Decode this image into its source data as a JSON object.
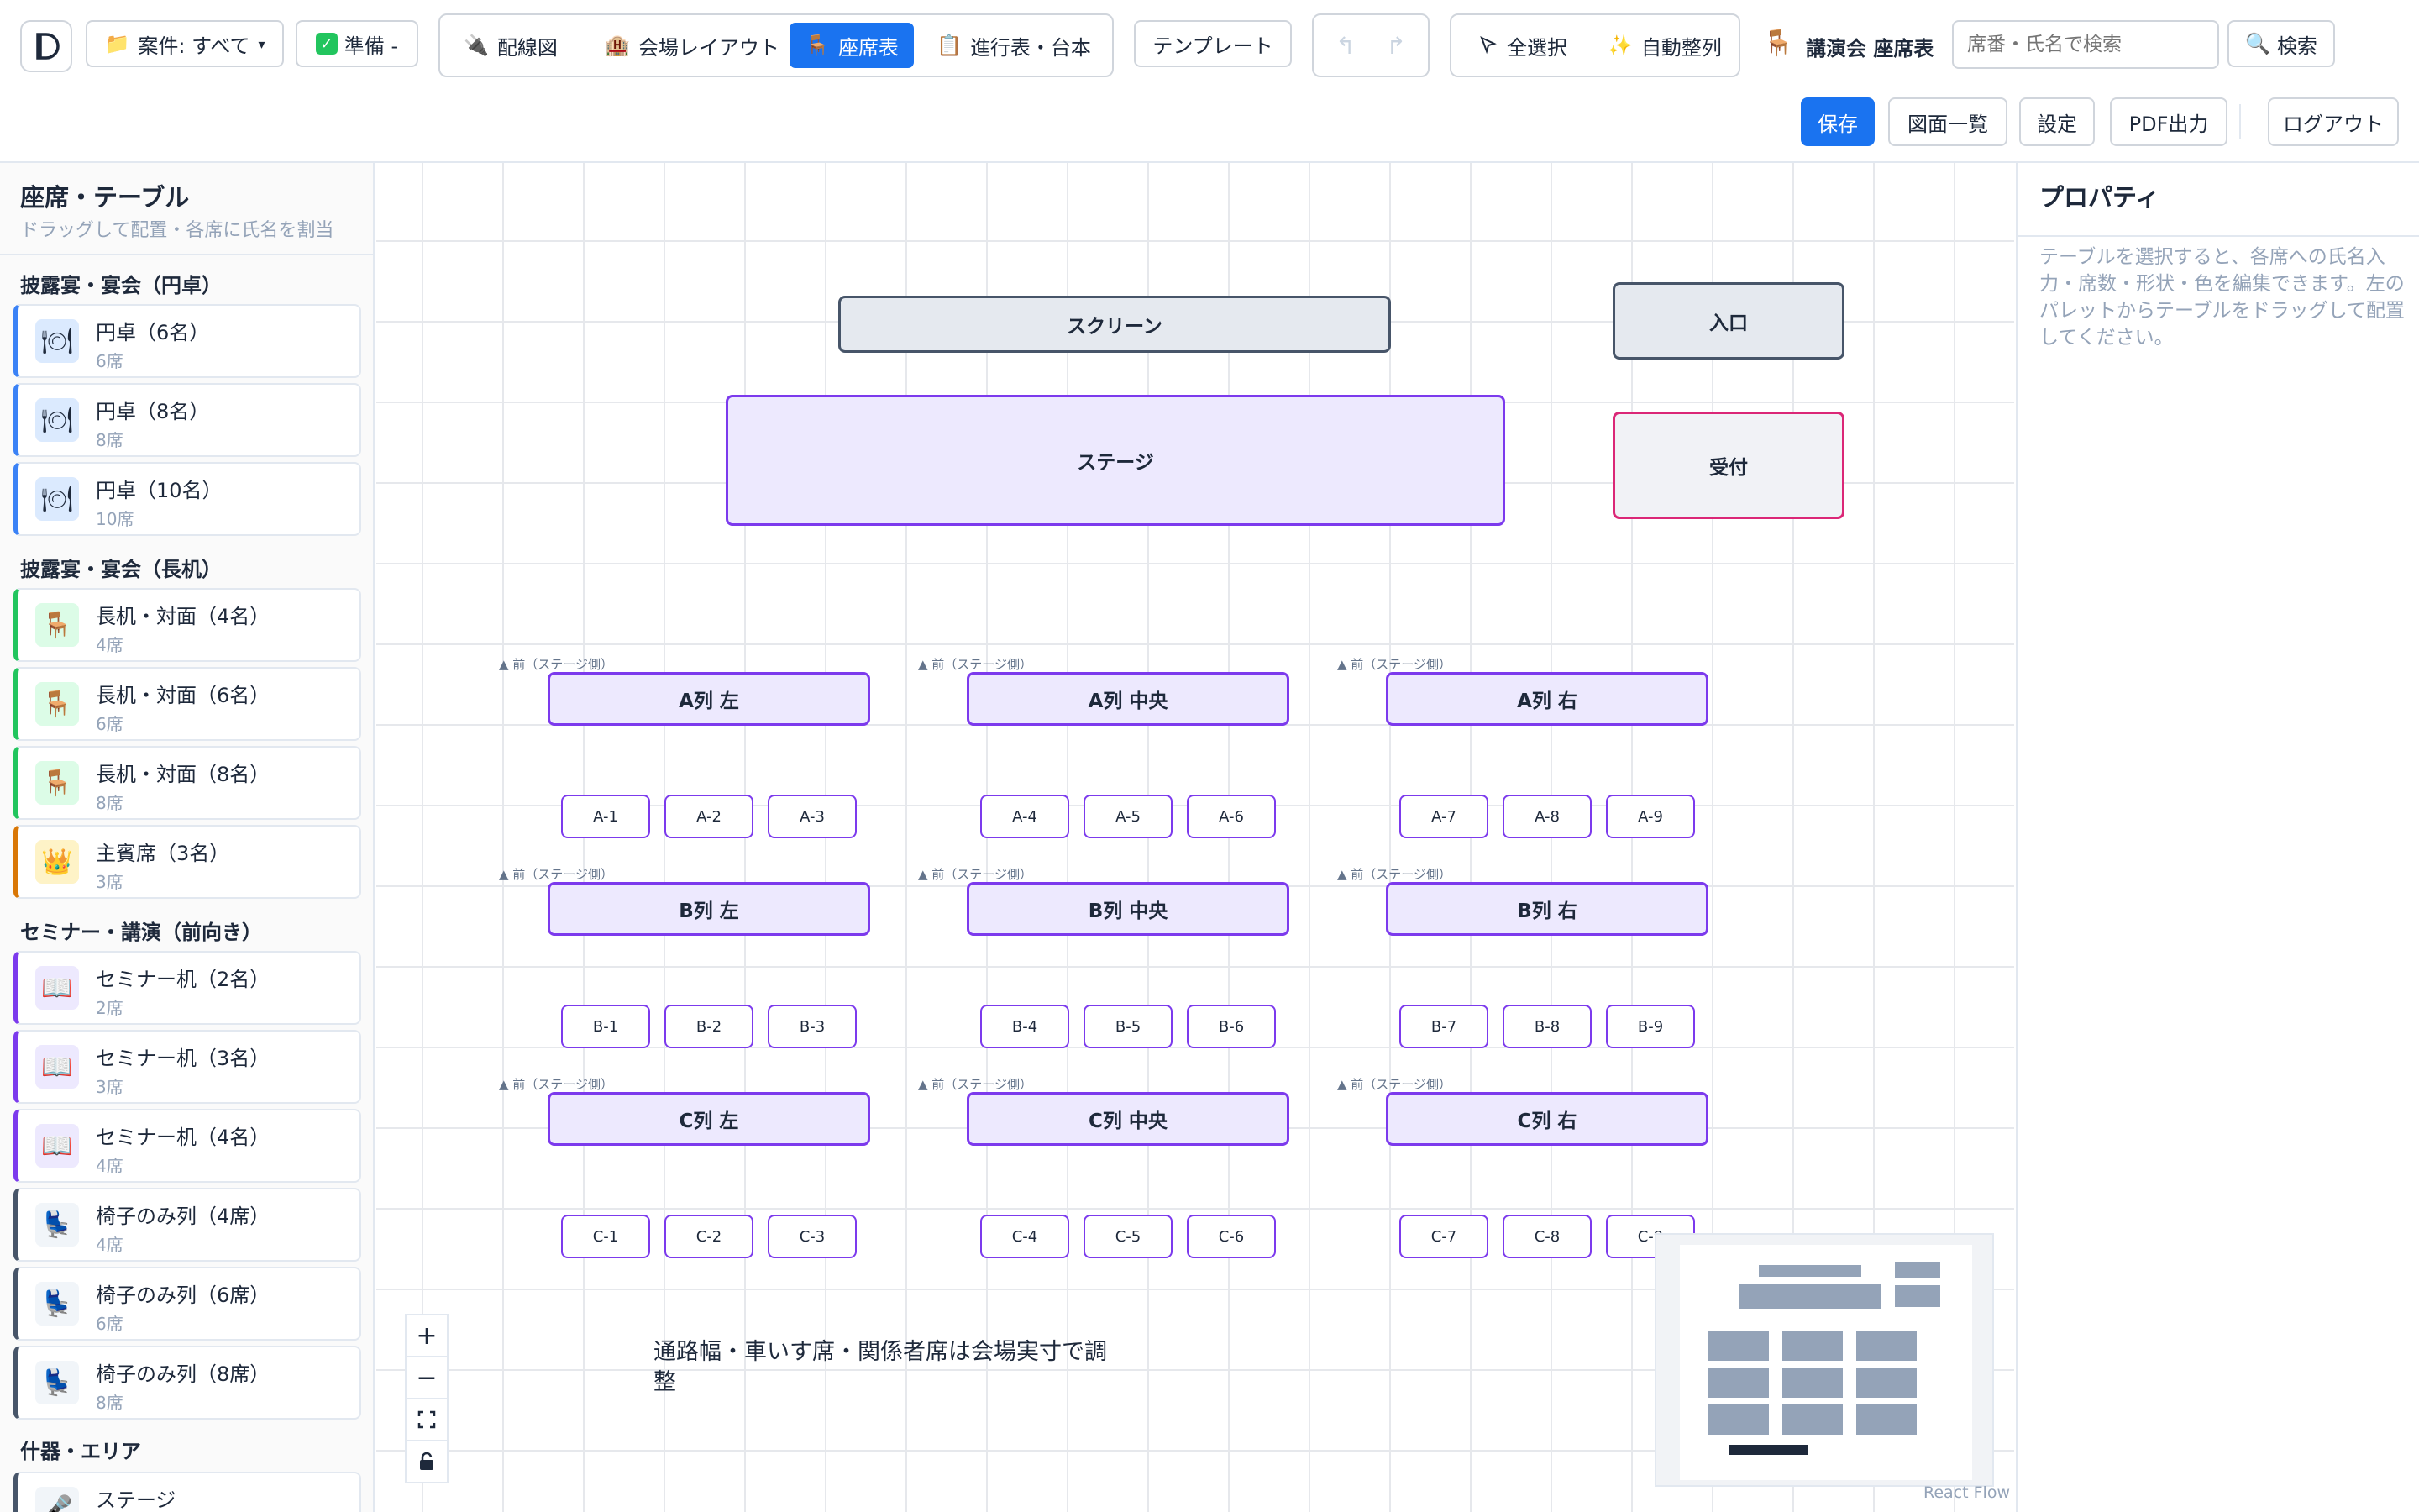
{
  "toolbar": {
    "project_filter": "案件: すべて",
    "status_filter": "準備 -",
    "tabs": [
      {
        "label": "配線図",
        "icon": "plug-icon"
      },
      {
        "label": "会場レイアウト",
        "icon": "building-icon"
      },
      {
        "label": "座席表",
        "icon": "chair-icon",
        "active": true
      },
      {
        "label": "進行表・台本",
        "icon": "clipboard-icon"
      }
    ],
    "template": "テンプレート",
    "select_all": "全選択",
    "auto_align": "自動整列",
    "doc_title": "講演会 座席表",
    "search_placeholder": "席番・氏名で検索",
    "search": "検索",
    "save": "保存",
    "drawings": "図面一覧",
    "settings": "設定",
    "pdf": "PDF出力",
    "logout": "ログアウト"
  },
  "sidebar": {
    "title": "座席・テーブル",
    "subtitle": "ドラッグして配置・各席に氏名を割当",
    "sections": [
      {
        "title": "披露宴・宴会（円卓）",
        "items": [
          {
            "label": "円卓（6名）",
            "sub": "6席",
            "icon": "plate-icon"
          },
          {
            "label": "円卓（8名）",
            "sub": "8席",
            "icon": "plate-icon"
          },
          {
            "label": "円卓（10名）",
            "sub": "10席",
            "icon": "plate-icon"
          }
        ]
      },
      {
        "title": "披露宴・宴会（長机）",
        "items": [
          {
            "label": "長机・対面（4名）",
            "sub": "4席",
            "icon": "chair-icon"
          },
          {
            "label": "長机・対面（6名）",
            "sub": "6席",
            "icon": "chair-icon"
          },
          {
            "label": "長机・対面（8名）",
            "sub": "8席",
            "icon": "chair-icon"
          },
          {
            "label": "主賓席（3名）",
            "sub": "3席",
            "icon": "crown-icon"
          }
        ]
      },
      {
        "title": "セミナー・講演（前向き）",
        "items": [
          {
            "label": "セミナー机（2名）",
            "sub": "2席",
            "icon": "book-icon"
          },
          {
            "label": "セミナー机（3名）",
            "sub": "3席",
            "icon": "book-icon"
          },
          {
            "label": "セミナー机（4名）",
            "sub": "4席",
            "icon": "book-icon"
          },
          {
            "label": "椅子のみ列（4席）",
            "sub": "4席",
            "icon": "seat-icon"
          },
          {
            "label": "椅子のみ列（6席）",
            "sub": "6席",
            "icon": "seat-icon"
          },
          {
            "label": "椅子のみ列（8席）",
            "sub": "8席",
            "icon": "seat-icon"
          }
        ]
      },
      {
        "title": "什器・エリア",
        "items": [
          {
            "label": "ステージ",
            "sub": "",
            "icon": "mic-icon"
          }
        ]
      }
    ]
  },
  "canvas": {
    "screen": "スクリーン",
    "entrance": "入口",
    "stage": "ステージ",
    "reception": "受付",
    "front_hint": "▲ 前（ステージ側）",
    "rows": [
      {
        "tables": [
          "A列 左",
          "A列 中央",
          "A列 右"
        ],
        "seats": [
          "A-1",
          "A-2",
          "A-3",
          "A-4",
          "A-5",
          "A-6",
          "A-7",
          "A-8",
          "A-9"
        ]
      },
      {
        "tables": [
          "B列 左",
          "B列 中央",
          "B列 右"
        ],
        "seats": [
          "B-1",
          "B-2",
          "B-3",
          "B-4",
          "B-5",
          "B-6",
          "B-7",
          "B-8",
          "B-9"
        ]
      },
      {
        "tables": [
          "C列 左",
          "C列 中央",
          "C列 右"
        ],
        "seats": [
          "C-1",
          "C-2",
          "C-3",
          "C-4",
          "C-5",
          "C-6",
          "C-7",
          "C-8",
          "C-9"
        ]
      }
    ],
    "note": "通路幅・車いす席・関係者席は会場実寸で調整",
    "attribution": "React Flow"
  },
  "props": {
    "title": "プロパティ",
    "desc": "テーブルを選択すると、各席への氏名入力・席数・形状・色を編集できます。左のパレットからテーブルをドラッグして配置してください。"
  },
  "colors": {
    "accent": "#1a73f0",
    "table_border": "#7c3aed",
    "table_fill": "#ede9fe",
    "reception_border": "#db2777"
  }
}
